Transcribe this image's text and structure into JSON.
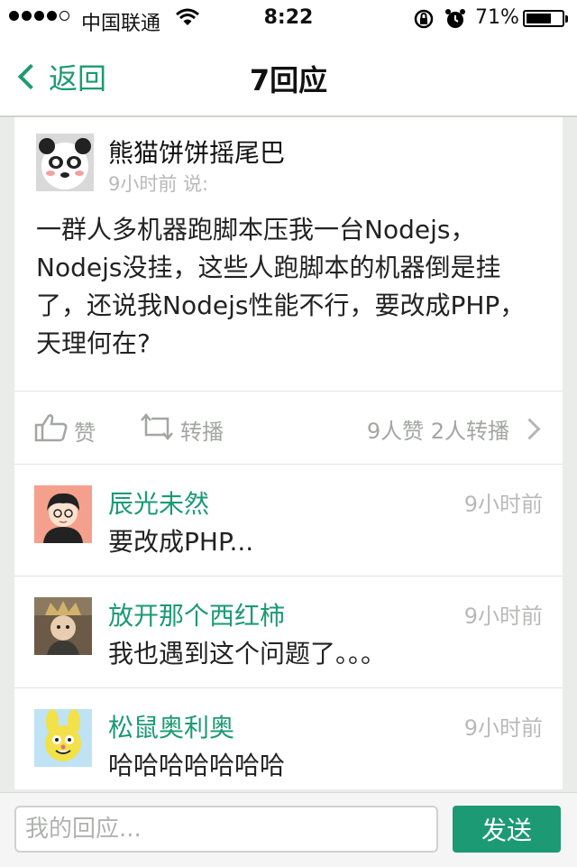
{
  "status_bar": {
    "carrier": "中国联通",
    "time": "8:22",
    "battery_percent": "71%",
    "battery_level": 0.71
  },
  "nav": {
    "back_label": "返回",
    "title": "7回应"
  },
  "post": {
    "author": "熊猫饼饼摇尾巴",
    "meta": "9小时前 说:",
    "body": "一群人多机器跑脚本压我一台Nodejs，Nodejs没挂，这些人跑脚本的机器倒是挂了，还说我Nodejs性能不行，要改成PHP，天理何在?"
  },
  "actions": {
    "like_label": "赞",
    "share_label": "转播",
    "stats": "9人赞 2人转播"
  },
  "replies": [
    {
      "name": "辰光未然",
      "time": "9小时前",
      "text": "要改成PHP..."
    },
    {
      "name": "放开那个西红柿",
      "time": "9小时前",
      "text": "我也遇到这个问题了。。。"
    },
    {
      "name": "松鼠奥利奥",
      "time": "9小时前",
      "text": "哈哈哈哈哈哈哈"
    }
  ],
  "composer": {
    "placeholder": "我的回应...",
    "value": "",
    "send_label": "发送"
  },
  "colors": {
    "accent": "#1c9a74",
    "muted": "#a3a6a3"
  }
}
